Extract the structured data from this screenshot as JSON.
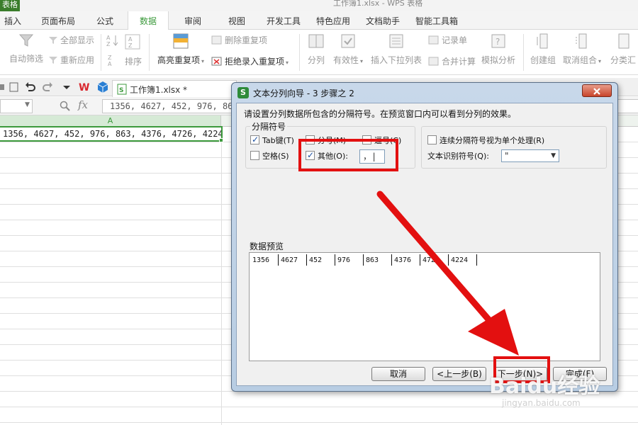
{
  "window": {
    "app_badge": "表格",
    "title": "工作簿1.xlsx - WPS 表格"
  },
  "menu": {
    "tabs": [
      {
        "label": "插入"
      },
      {
        "label": "页面布局"
      },
      {
        "label": "公式"
      },
      {
        "label": "数据",
        "active": true
      },
      {
        "label": "审阅"
      },
      {
        "label": "视图"
      },
      {
        "label": "开发工具"
      },
      {
        "label": "特色应用"
      },
      {
        "label": "文档助手"
      },
      {
        "label": "智能工具箱"
      }
    ]
  },
  "toolbar": {
    "auto_filter": "自动筛选",
    "show_all": "全部显示",
    "reapply": "重新应用",
    "sort": "排序",
    "highlight_duplicates": "高亮重复项",
    "delete_duplicates": "删除重复项",
    "reject_duplicates": "拒绝录入重复项",
    "split_column": "分列",
    "validity": "有效性",
    "insert_dropdown": "插入下拉列表",
    "record_sheet": "记录单",
    "consolidate": "合并计算",
    "what_if": "模拟分析",
    "create_group": "创建组",
    "ungroup": "取消组合",
    "subtotal": "分类汇"
  },
  "tabs_bar": {
    "file_tab": "工作簿1.xlsx *"
  },
  "formula_bar": {
    "value": "1356, 4627, 452, 976, 863, 4376, 4726, 4224"
  },
  "sheet": {
    "column_a": "A",
    "cell_a1": "1356, 4627, 452, 976, 863, 4376, 4726, 4224"
  },
  "dialog": {
    "title": "文本分列向导 - 3 步骤之 2",
    "instruction": "请设置分列数据所包含的分隔符号。在预览窗口内可以看到分列的效果。",
    "delimiter_group_label": "分隔符号",
    "delimiters": {
      "tab": {
        "label": "Tab键(T)",
        "checked": true
      },
      "semicolon": {
        "label": "分号(M)",
        "checked": false
      },
      "comma": {
        "label": "逗号(C)",
        "checked": false
      },
      "space": {
        "label": "空格(S)",
        "checked": false
      },
      "other": {
        "label": "其他(O):",
        "checked": true,
        "value": "，|"
      }
    },
    "consecutive_label": "连续分隔符号视为单个处理(R)",
    "text_qualifier_label": "文本识别符号(Q):",
    "text_qualifier_value": "\"",
    "preview_label": "数据预览",
    "preview_values": [
      "1356",
      "4627",
      "452",
      "976",
      "863",
      "4376",
      "4726",
      "4224"
    ],
    "buttons": {
      "cancel": "取消",
      "back": "<上一步(B)",
      "next": "下一步(N)>",
      "finish": "完成(F)"
    }
  },
  "watermark": {
    "brand": "Baidu经验",
    "url": "jingyan.baidu.com"
  },
  "colors": {
    "accent_green": "#3c9a3c",
    "annotation_red": "#e31010",
    "dialog_frame": "#b8cde3"
  }
}
